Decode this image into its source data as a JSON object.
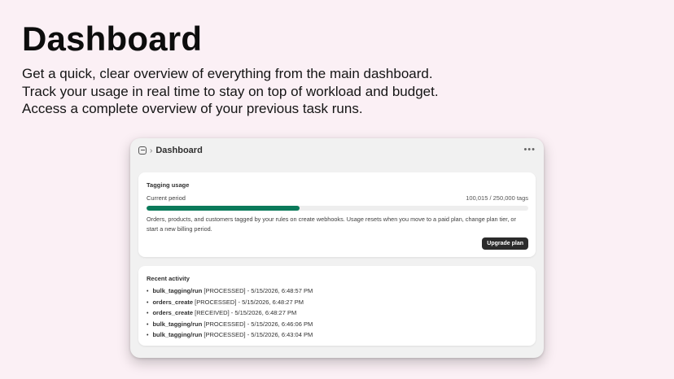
{
  "hero": {
    "title": "Dashboard",
    "lines": [
      "Get a quick, clear overview of everything from the main dashboard.",
      "Track your usage in real time to stay on top of workload and budget.",
      "Access a complete overview of your previous task runs."
    ]
  },
  "window": {
    "breadcrumb_separator": "›",
    "title": "Dashboard",
    "more_label": "•••"
  },
  "usage": {
    "title": "Tagging usage",
    "period_label": "Current period",
    "count_text": "100,015 / 250,000 tags",
    "progress_fraction": 0.40006,
    "description": "Orders, products, and customers tagged by your rules on create webhooks. Usage resets when you move to a paid plan, change plan tier, or start a new billing period.",
    "upgrade_label": "Upgrade plan",
    "accent_color": "#0b7a5a"
  },
  "activity": {
    "title": "Recent activity",
    "bullet": "•",
    "items": [
      {
        "name": "bulk_tagging/run",
        "detail": " [PROCESSED] - 5/15/2026, 6:48:57 PM"
      },
      {
        "name": "orders_create",
        "detail": " [PROCESSED] - 5/15/2026, 6:48:27 PM"
      },
      {
        "name": "orders_create",
        "detail": " [RECEIVED] - 5/15/2026, 6:48:27 PM"
      },
      {
        "name": "bulk_tagging/run",
        "detail": " [PROCESSED] - 5/15/2026, 6:46:06 PM"
      },
      {
        "name": "bulk_tagging/run",
        "detail": " [PROCESSED] - 5/15/2026, 6:43:04 PM"
      }
    ]
  }
}
